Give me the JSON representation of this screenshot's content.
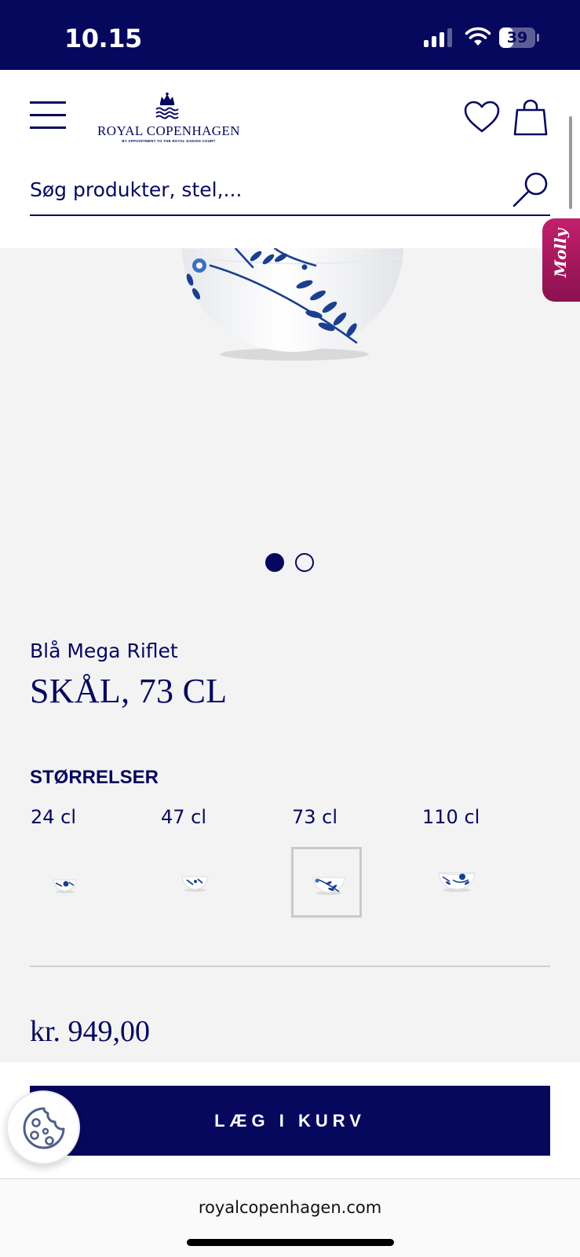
{
  "status_bar": {
    "time": "10.15",
    "battery": "39",
    "battery_level": 0.39,
    "signal_bars_active": 3
  },
  "header": {
    "logo": {
      "wordmark": "ROYAL COPENHAGEN",
      "tagline": "BY APPOINTMENT TO THE ROYAL DANISH COURT"
    },
    "search": {
      "placeholder": "Søg produkter, stel,..."
    },
    "icons": {
      "menu": "hamburger-menu-icon",
      "wishlist": "heart-icon",
      "cart": "shopping-bag-icon",
      "search": "search-icon"
    }
  },
  "assistant_tab": {
    "label": "Molly"
  },
  "product": {
    "collection": "Blå Mega Riflet",
    "title": "SKÅL, 73 CL",
    "gallery": {
      "total_images": 2,
      "current_index": 0
    },
    "sizes_heading": "STØRRELSER",
    "sizes": [
      {
        "label": "24 cl",
        "selected": false
      },
      {
        "label": "47 cl",
        "selected": false
      },
      {
        "label": "73 cl",
        "selected": true
      },
      {
        "label": "110 cl",
        "selected": false
      }
    ],
    "price": "kr. 949,00"
  },
  "actions": {
    "add_to_cart": "LÆG I KURV",
    "cookie_settings_icon": "cookie-icon"
  },
  "browser": {
    "url": "royalcopenhagen.com"
  },
  "colors": {
    "brand_navy": "#06085e",
    "page_background": "#f3f3f4",
    "molly_pink": "#c31f6c",
    "porcelain_blue": "#1a3f8f"
  }
}
